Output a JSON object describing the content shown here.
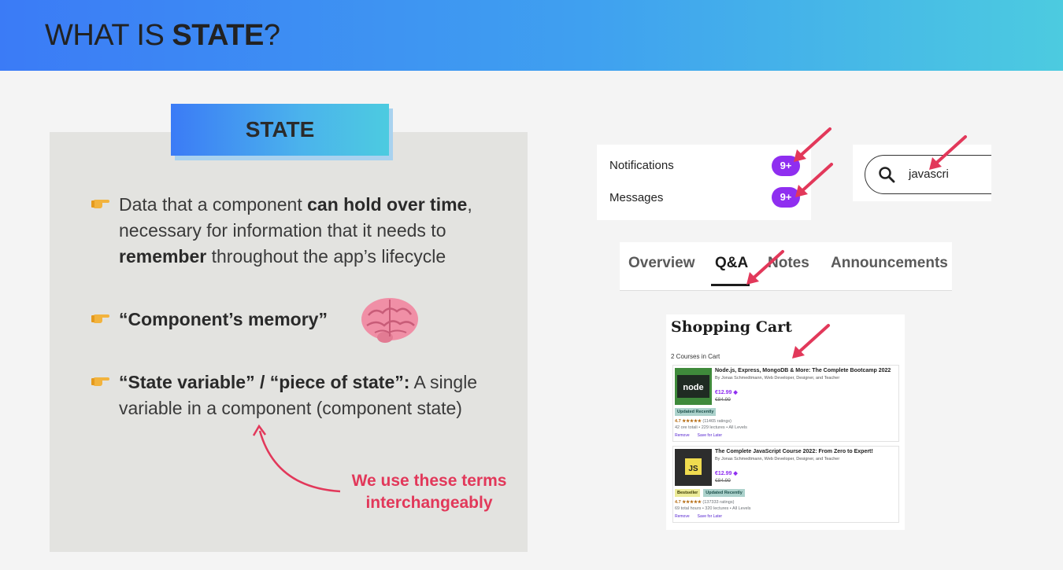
{
  "header": {
    "title_prefix": "WHAT IS ",
    "title_bold": "STATE",
    "title_suffix": "?"
  },
  "state_box": {
    "title": "STATE"
  },
  "bullets": [
    {
      "parts": [
        "Data that a component ",
        "can hold over time",
        ",",
        " necessary for information that it needs to ",
        "remember",
        " throughout the app’s lifecycle"
      ]
    },
    {
      "parts": [
        "“Component’s memory”"
      ]
    },
    {
      "parts": [
        "“State variable” / “piece of state”",
        ":",
        " A single variable in a component (component state)"
      ]
    }
  ],
  "note": {
    "line1": "We use these terms",
    "line2": "interchangeably"
  },
  "notifications": {
    "rows": [
      {
        "label": "Notifications",
        "badge": "9+"
      },
      {
        "label": "Messages",
        "badge": "9+"
      }
    ]
  },
  "search": {
    "value": "javascri",
    "icon": "search-icon"
  },
  "tabs": [
    {
      "label": "Overview",
      "active": false
    },
    {
      "label": "Q&A",
      "active": true
    },
    {
      "label": "Notes",
      "active": false
    },
    {
      "label": "Announcements",
      "active": false
    }
  ],
  "cart": {
    "title": "Shopping Cart",
    "count": "2 Courses in Cart",
    "courses": [
      {
        "title": "Node.js, Express, MongoDB & More: The Complete Bootcamp 2022",
        "by": "By Jonas Schmedtmann, Web Developer, Designer, and Teacher",
        "price": "€12.99",
        "old_price": "€84.99",
        "tags": [
          "Updated Recently"
        ],
        "rating": "4.7",
        "stars": "★★★★★",
        "ratings_count": "(11465 ratings)",
        "meta": "42 ore totali • 229 lectures • All Levels",
        "actions": [
          "Remove",
          "Save for Later"
        ],
        "thumb_text": "node"
      },
      {
        "title": "The Complete JavaScript Course 2022: From Zero to Expert!",
        "by": "By Jonas Schmedtmann, Web Developer, Designer, and Teacher",
        "price": "€12.99",
        "old_price": "€84.99",
        "tags": [
          "Bestseller",
          "Updated Recently"
        ],
        "rating": "4.7",
        "stars": "★★★★★",
        "ratings_count": "(137333 ratings)",
        "meta": "69 total hours • 320 lectures • All Levels",
        "actions": [
          "Remove",
          "Save for Later"
        ],
        "thumb_text": "JS"
      }
    ]
  },
  "colors": {
    "accent_red": "#e2385a",
    "badge_purple": "#8f2ef0",
    "header_start": "#3b7bf6",
    "header_end": "#4ccbe0"
  }
}
